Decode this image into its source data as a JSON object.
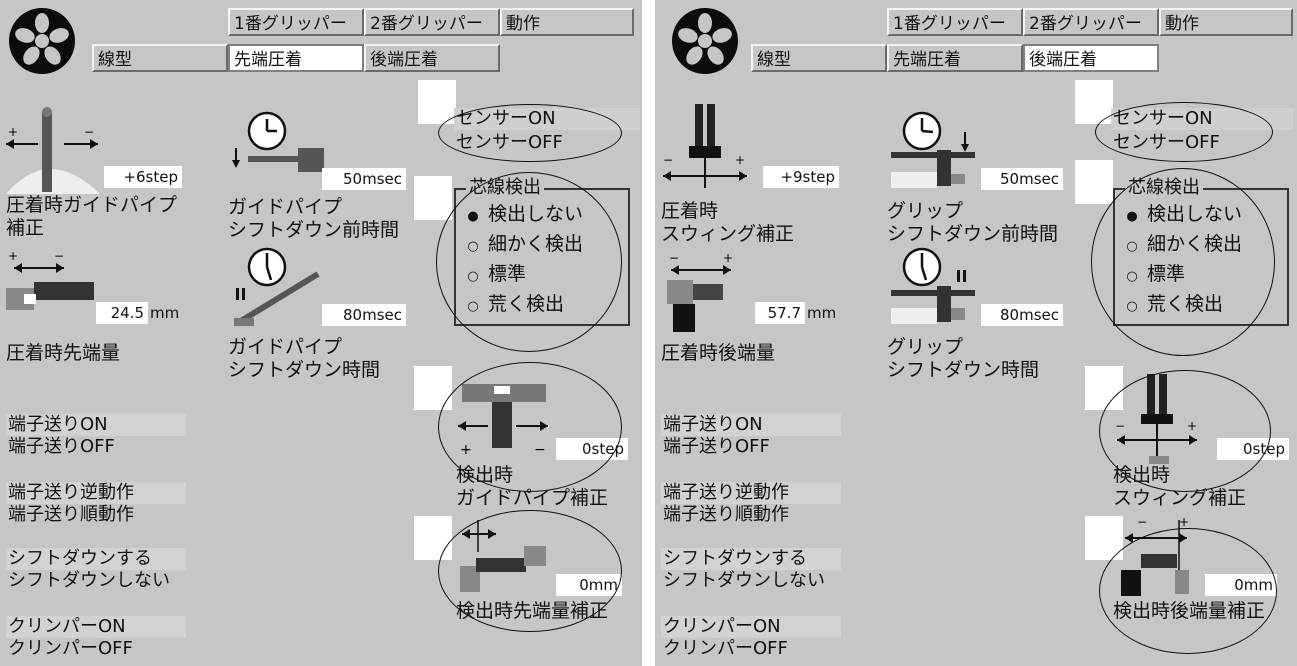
{
  "tabs": {
    "gripper1": "1番グリッパー",
    "gripper2": "2番グリッパー",
    "motion": "動作",
    "wire_type": "線型",
    "front_crimp": "先端圧着",
    "rear_crimp": "後端圧着"
  },
  "left": {
    "active_tab": "先端圧着",
    "settings": [
      {
        "label": "圧着時ガイドパイプ\n補正",
        "value": "+6step"
      },
      {
        "label": "ガイドパイプ\nシフトダウン前時間",
        "value": "50msec"
      },
      {
        "label": "圧着時先端量",
        "value": "24.5",
        "unit": "mm"
      },
      {
        "label": "ガイドパイプ\nシフトダウン時間",
        "value": "80msec"
      }
    ],
    "detect": [
      {
        "label": "検出時\nガイドパイプ補正",
        "value": "0step"
      },
      {
        "label": "検出時先端量補正",
        "value": "0mm"
      }
    ]
  },
  "right": {
    "active_tab": "後端圧着",
    "settings": [
      {
        "label": "圧着時\nスウィング補正",
        "value": "+9step"
      },
      {
        "label": "グリップ\nシフトダウン前時間",
        "value": "50msec"
      },
      {
        "label": "圧着時後端量",
        "value": "57.7",
        "unit": "mm"
      },
      {
        "label": "グリップ\nシフトダウン時間",
        "value": "80msec"
      }
    ],
    "detect": [
      {
        "label": "検出時\nスウィング補正",
        "value": "0step"
      },
      {
        "label": "検出時後端量補正",
        "value": "0mm"
      }
    ]
  },
  "sensor": {
    "on": "センサーON",
    "off": "センサーOFF"
  },
  "core_detection": {
    "title": "芯線検出",
    "options": [
      "検出しない",
      "細かく検出",
      "標準",
      "荒く検出"
    ],
    "selected_index": 0
  },
  "toggles": [
    {
      "on": "端子送りON",
      "off": "端子送りOFF"
    },
    {
      "on": "端子送り逆動作",
      "off": "端子送り順動作"
    },
    {
      "on": "シフトダウンする",
      "off": "シフトダウンしない"
    },
    {
      "on": "クリンパーON",
      "off": "クリンパーOFF"
    }
  ],
  "icons": {
    "logo": "fan-logo-icon",
    "clock": "clock-icon",
    "guide_pipe": "guide-pipe-icon",
    "crimp_position": "crimp-position-icon",
    "swing": "swing-icon",
    "gripper": "gripper-icon"
  },
  "colors": {
    "panel_bg": "#c6c6c6",
    "field_bg": "#ffffff",
    "ink": "#111111"
  }
}
